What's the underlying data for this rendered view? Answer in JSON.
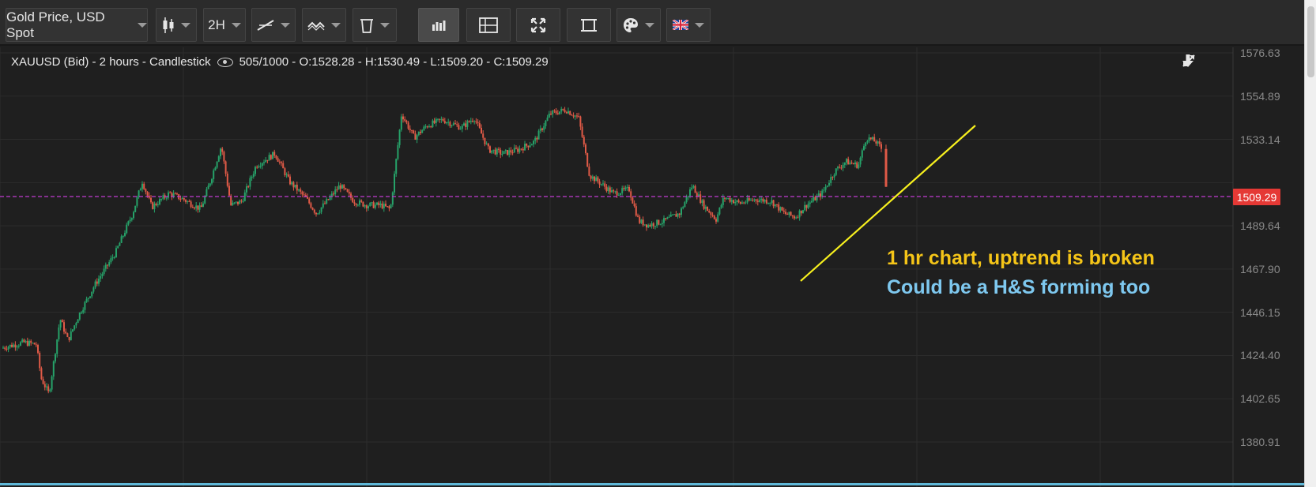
{
  "toolbar": {
    "instrument": "Gold Price, USD Spot",
    "timeframe": "2H"
  },
  "chart": {
    "info": {
      "title": "XAUUSD (Bid) - 2 hours - Candlestick",
      "ohlc": "505/1000 - O:1528.28 - H:1530.49 - L:1509.20 - C:1509.29"
    },
    "current_price": "1509.29",
    "y_axis_labels": [
      "1576.63",
      "1554.89",
      "1533.14",
      "1489.64",
      "1467.90",
      "1446.15",
      "1424.40",
      "1402.65",
      "1380.91"
    ],
    "annotations": {
      "line1": "1 hr chart,  uptrend is broken",
      "line2": "Could be a H&S forming too"
    },
    "colors": {
      "up": "#26a269",
      "down": "#e05a47",
      "trendline": "#f7f01e",
      "price_line": "#c03ad0",
      "price_tag": "#e53935"
    }
  },
  "chart_data": {
    "type": "candlestick",
    "title": "XAUUSD (Bid) - 2 hours - Candlestick",
    "ylim": [
      1380.91,
      1576.63
    ],
    "yticks": [
      1576.63,
      1554.89,
      1533.14,
      1511.39,
      1489.64,
      1467.9,
      1446.15,
      1424.4,
      1402.65,
      1380.91
    ],
    "open": 1528.28,
    "high": 1530.49,
    "low": 1509.2,
    "close": 1509.29,
    "path": [
      [
        0,
        1428
      ],
      [
        30,
        1431
      ],
      [
        46,
        1430
      ],
      [
        52,
        1413
      ],
      [
        62,
        1405
      ],
      [
        76,
        1443
      ],
      [
        86,
        1432
      ],
      [
        100,
        1445
      ],
      [
        120,
        1460
      ],
      [
        146,
        1476
      ],
      [
        168,
        1496
      ],
      [
        180,
        1512
      ],
      [
        192,
        1499
      ],
      [
        214,
        1506
      ],
      [
        232,
        1503
      ],
      [
        254,
        1498
      ],
      [
        266,
        1512
      ],
      [
        280,
        1530
      ],
      [
        292,
        1500
      ],
      [
        306,
        1502
      ],
      [
        324,
        1520
      ],
      [
        348,
        1526
      ],
      [
        366,
        1512
      ],
      [
        388,
        1503
      ],
      [
        400,
        1496
      ],
      [
        416,
        1503
      ],
      [
        430,
        1510
      ],
      [
        448,
        1502
      ],
      [
        464,
        1500
      ],
      [
        482,
        1500
      ],
      [
        494,
        1498
      ],
      [
        508,
        1546
      ],
      [
        524,
        1534
      ],
      [
        540,
        1540
      ],
      [
        560,
        1543
      ],
      [
        584,
        1539
      ],
      [
        600,
        1544
      ],
      [
        618,
        1528
      ],
      [
        636,
        1526
      ],
      [
        656,
        1528
      ],
      [
        676,
        1532
      ],
      [
        696,
        1546
      ],
      [
        716,
        1548
      ],
      [
        732,
        1544
      ],
      [
        746,
        1515
      ],
      [
        760,
        1511
      ],
      [
        776,
        1506
      ],
      [
        796,
        1508
      ],
      [
        808,
        1492
      ],
      [
        820,
        1490
      ],
      [
        840,
        1492
      ],
      [
        860,
        1496
      ],
      [
        876,
        1510
      ],
      [
        890,
        1500
      ],
      [
        906,
        1493
      ],
      [
        916,
        1504
      ],
      [
        936,
        1501
      ],
      [
        956,
        1503
      ],
      [
        976,
        1502
      ],
      [
        992,
        1496
      ],
      [
        1006,
        1494
      ],
      [
        1020,
        1500
      ],
      [
        1040,
        1506
      ],
      [
        1056,
        1517
      ],
      [
        1070,
        1522
      ],
      [
        1086,
        1520
      ],
      [
        1096,
        1534
      ],
      [
        1108,
        1532
      ],
      [
        1116,
        1528
      ],
      [
        1121,
        1509
      ]
    ]
  }
}
